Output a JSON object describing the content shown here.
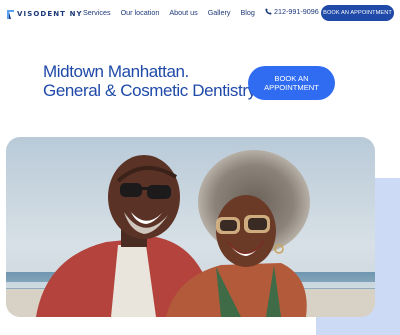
{
  "brand": {
    "logo_text": "VISODENT NY",
    "logo_icon": "tooth-logo-icon"
  },
  "nav": {
    "items": [
      "Services",
      "Our location",
      "About us",
      "Gallery",
      "Blog"
    ]
  },
  "header": {
    "phone": "212-991-9096",
    "phone_icon": "phone-icon",
    "cta_label": "BOOK AN APPOINTMENT"
  },
  "hero": {
    "title_line1": "Midtown Manhattan.",
    "title_line2": "General & Cosmetic Dentistry.",
    "cta_label": "BOOK AN APPOINTMENT"
  },
  "image": {
    "subject": "hero-photo-smiling-couple"
  },
  "colors": {
    "primary": "#1f4aa8",
    "accent": "#2f6cf2",
    "panel": "#cddaf6"
  }
}
